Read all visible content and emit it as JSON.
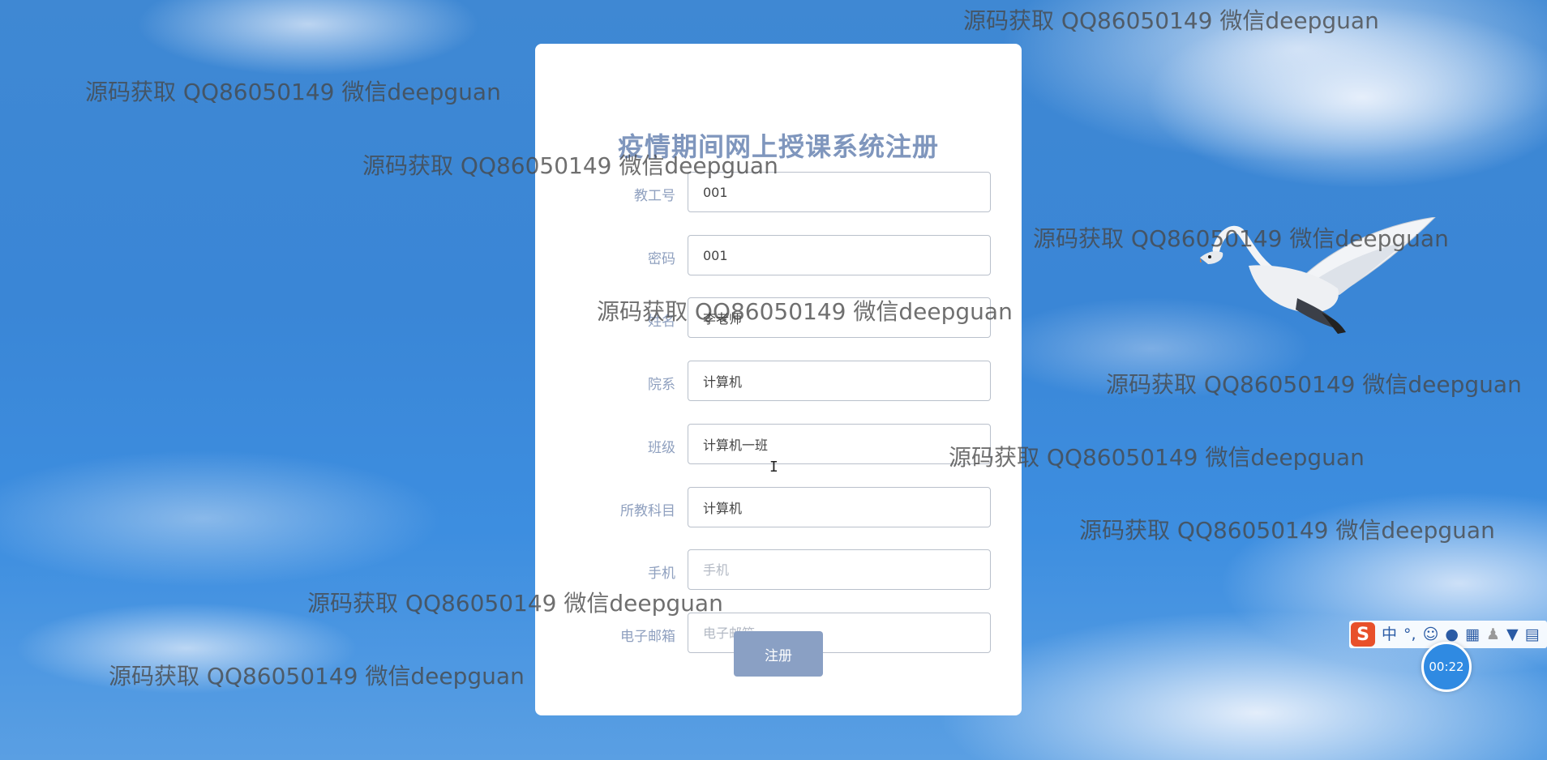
{
  "form": {
    "title": "疫情期间网上授课系统注册",
    "fields": [
      {
        "label": "教工号",
        "value": "001",
        "placeholder": ""
      },
      {
        "label": "密码",
        "value": "001",
        "placeholder": ""
      },
      {
        "label": "姓名",
        "value": "李老师",
        "placeholder": ""
      },
      {
        "label": "院系",
        "value": "计算机",
        "placeholder": ""
      },
      {
        "label": "班级",
        "value": "计算机一班",
        "placeholder": ""
      },
      {
        "label": "所教科目",
        "value": "计算机",
        "placeholder": ""
      },
      {
        "label": "手机",
        "value": "",
        "placeholder": "手机"
      },
      {
        "label": "电子邮箱",
        "value": "",
        "placeholder": "电子邮箱"
      }
    ],
    "submit_label": "注册"
  },
  "watermark": {
    "text": "源码获取 QQ86050149 微信deepguan"
  },
  "ime_toolbar": {
    "logo": "S",
    "mode": "中",
    "punct": "°,",
    "icons": [
      "emoji-icon",
      "microphone-icon",
      "keyboard-icon",
      "user-icon",
      "skin-icon",
      "toolbox-icon"
    ]
  },
  "timer": {
    "text": "00:22"
  },
  "colors": {
    "title": "#7f96bd",
    "label": "#8fa0bf",
    "button": "#8aa0c4",
    "sky": "#3a86d6"
  }
}
